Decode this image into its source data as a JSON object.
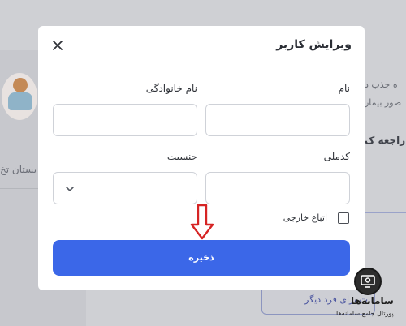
{
  "modal": {
    "title": "ویرایش کاربر",
    "fields": {
      "first_name_label": "نام",
      "last_name_label": "نام خانوادگی",
      "national_code_label": "کدملی",
      "gender_label": "جنسیت",
      "first_name_value": "",
      "last_name_value": "",
      "national_code_value": "",
      "gender_value": ""
    },
    "foreign_national_label": "اتباع خارجی",
    "save_label": "ذخیره"
  },
  "background": {
    "left_text": "بستان تخ",
    "right_text_1": "ه جذب د",
    "right_text_2": "صور بیمار",
    "right_text_3": "راجعه ک",
    "bottom_button": "ت برای فرد دیگر"
  },
  "watermark": {
    "title": "سامانه‌ها",
    "subtitle": "پورتال جامع سامانه‌ها"
  },
  "colors": {
    "primary": "#3b67e8",
    "arrow": "#d62424",
    "overlay": "#cfd0d4"
  }
}
